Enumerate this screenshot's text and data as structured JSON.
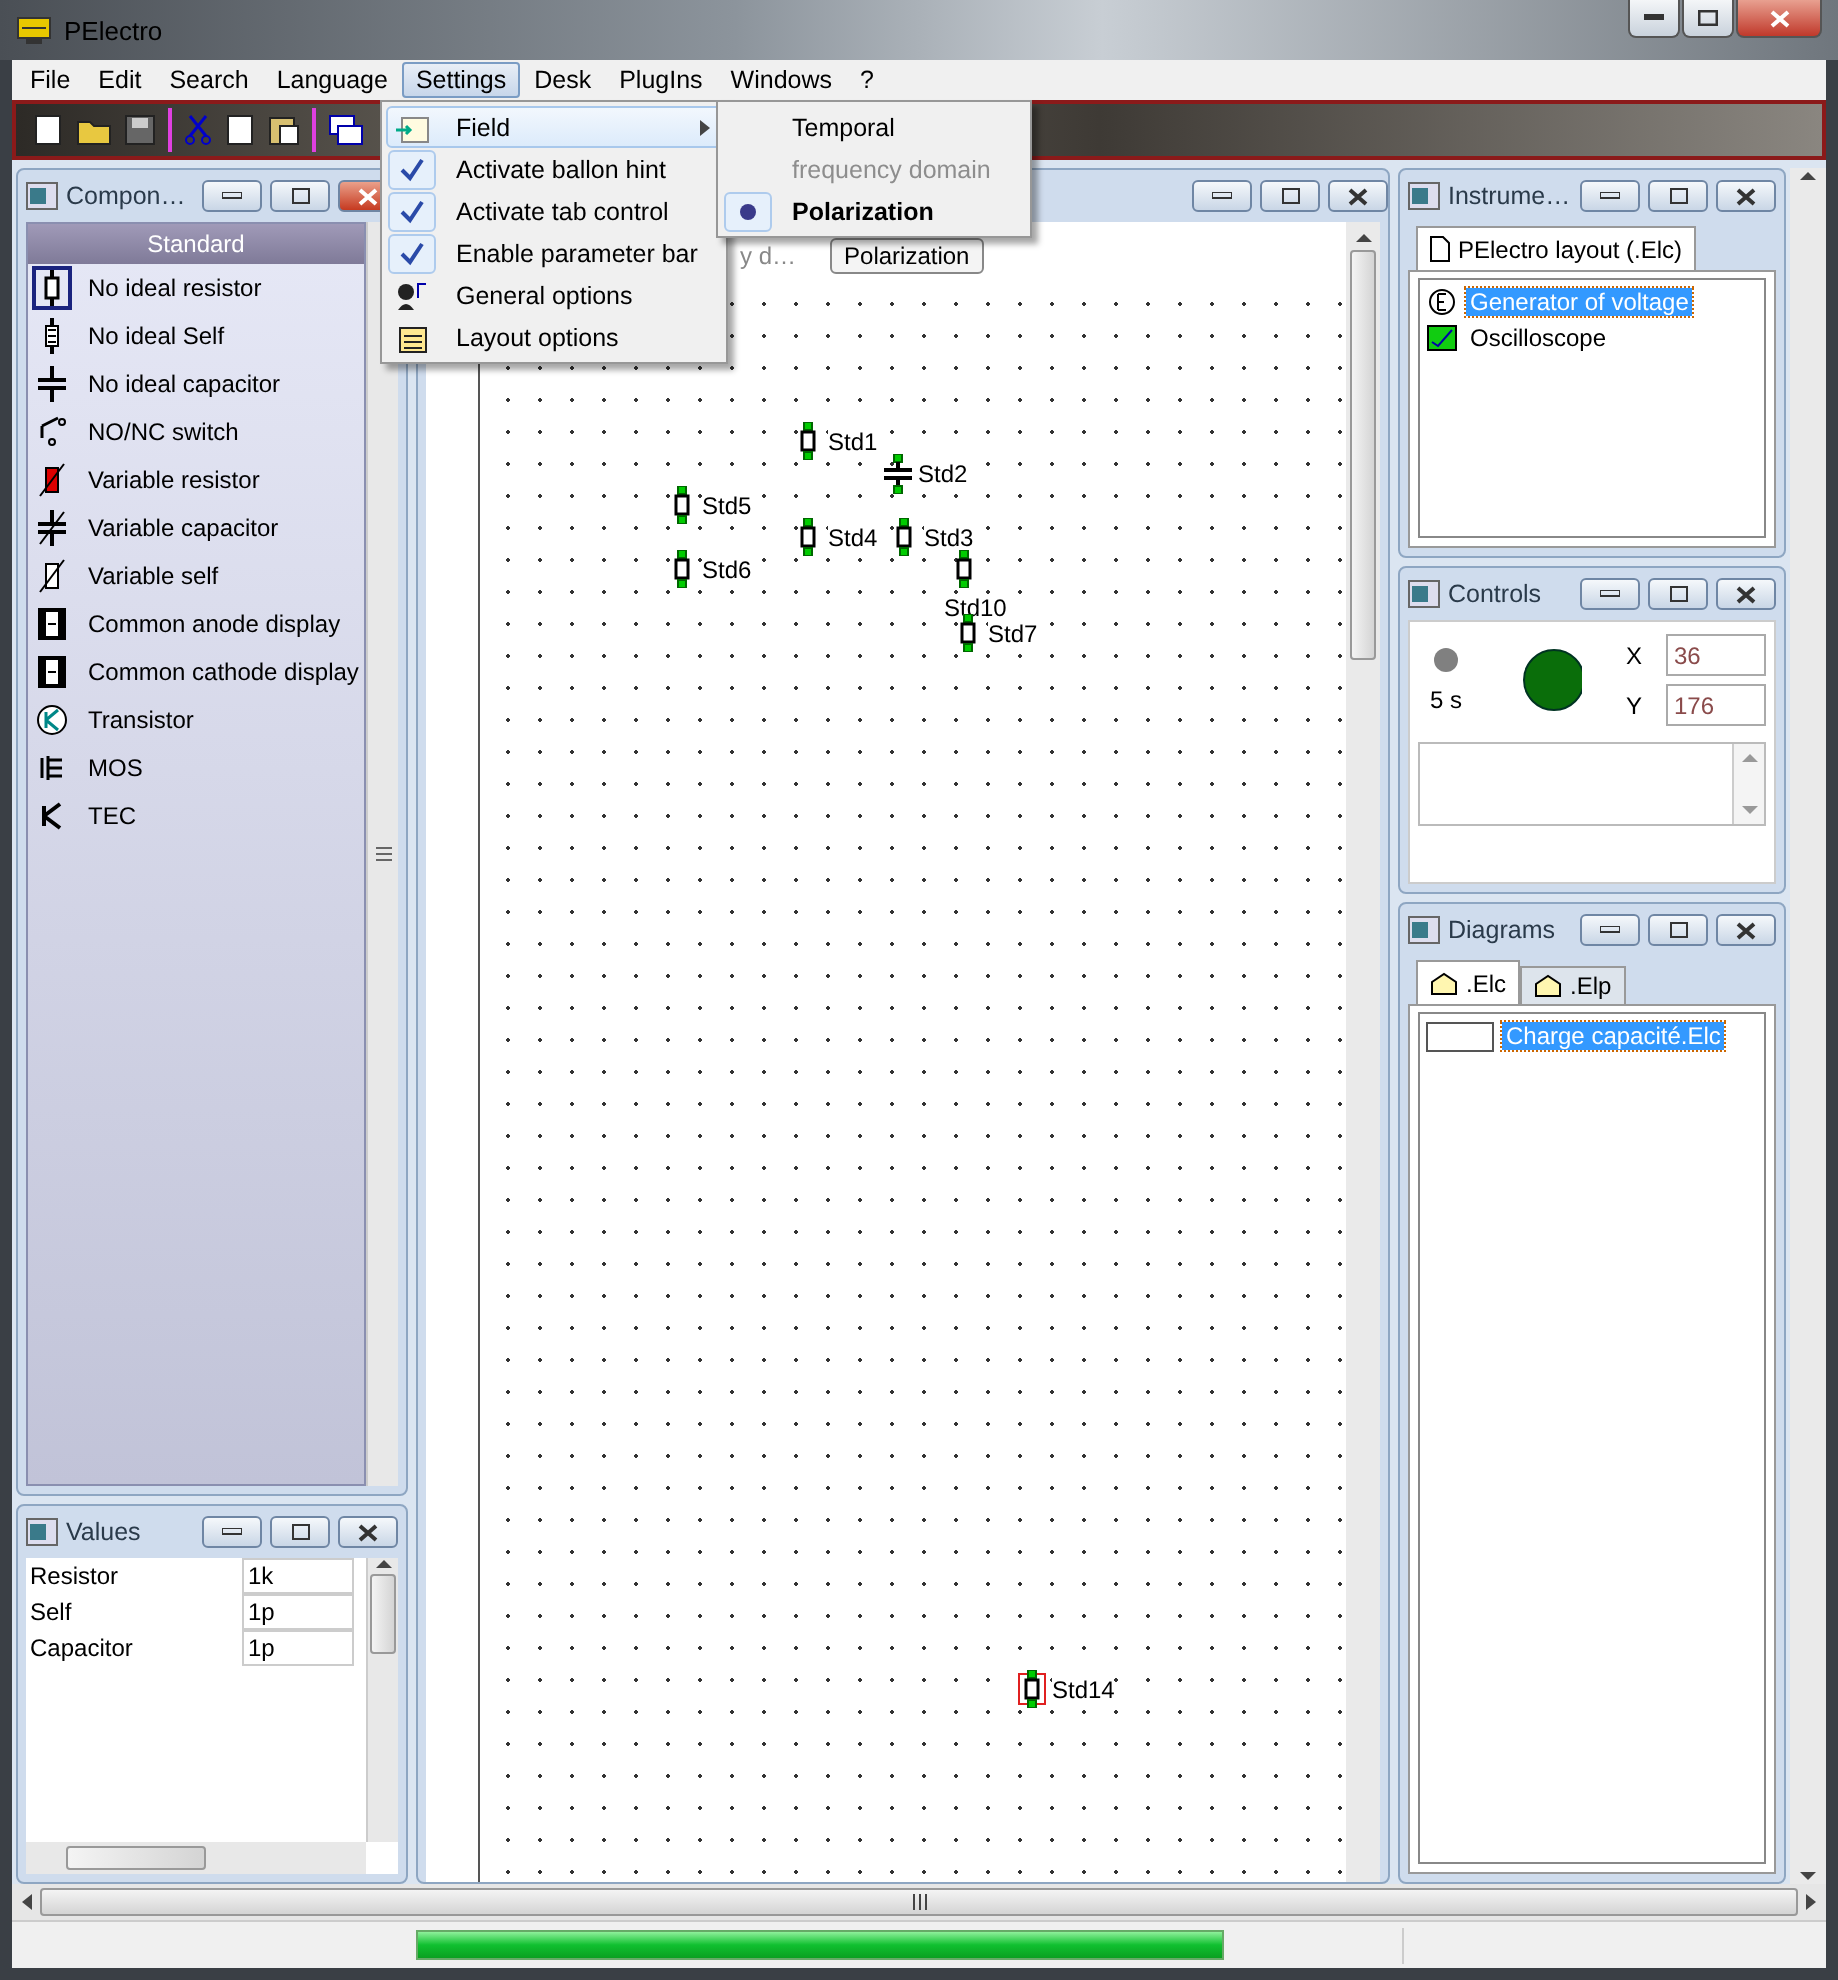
{
  "window": {
    "title": "PElectro"
  },
  "menu_bar": [
    {
      "label": "File",
      "selected": false
    },
    {
      "label": "Edit",
      "selected": false
    },
    {
      "label": "Search",
      "selected": false
    },
    {
      "label": "Language",
      "selected": false
    },
    {
      "label": "Settings",
      "selected": true
    },
    {
      "label": "Desk",
      "selected": false
    },
    {
      "label": "PlugIns",
      "selected": false
    },
    {
      "label": "Windows",
      "selected": false
    },
    {
      "label": "?",
      "selected": false
    }
  ],
  "settings_menu": [
    {
      "kind": "submenu",
      "label": "Field",
      "highlighted": true,
      "checked": false
    },
    {
      "kind": "check",
      "label": "Activate ballon hint",
      "highlighted": false,
      "checked": true
    },
    {
      "kind": "check",
      "label": "Activate tab control",
      "highlighted": false,
      "checked": true
    },
    {
      "kind": "check",
      "label": "Enable parameter bar",
      "highlighted": false,
      "checked": true
    },
    {
      "kind": "general",
      "label": "General options",
      "highlighted": false,
      "checked": false
    },
    {
      "kind": "layout",
      "label": "Layout options",
      "highlighted": false,
      "checked": false
    }
  ],
  "field_submenu": [
    {
      "label": "Temporal",
      "selected": false,
      "disabled": false
    },
    {
      "label": "frequency domain",
      "selected": false,
      "disabled": true
    },
    {
      "label": "Polarization",
      "selected": true,
      "disabled": false
    }
  ],
  "components_panel": {
    "title": "Compon…",
    "group": "Standard",
    "items": [
      {
        "kind": "resistor",
        "label": "No ideal resistor",
        "selected": true
      },
      {
        "kind": "self",
        "label": "No ideal Self",
        "selected": false
      },
      {
        "kind": "capacitor",
        "label": "No ideal capacitor",
        "selected": false
      },
      {
        "kind": "switch",
        "label": "NO/NC switch",
        "selected": false
      },
      {
        "kind": "variable_resistor",
        "label": "Variable resistor",
        "selected": false
      },
      {
        "kind": "variable_capacitor",
        "label": "Variable capacitor",
        "selected": false
      },
      {
        "kind": "variable_self",
        "label": "Variable self",
        "selected": false
      },
      {
        "kind": "display",
        "label": "Common anode display",
        "selected": false
      },
      {
        "kind": "display",
        "label": "Common cathode display",
        "selected": false
      },
      {
        "kind": "transistor",
        "label": "Transistor",
        "selected": false
      },
      {
        "kind": "mos",
        "label": "MOS",
        "selected": false
      },
      {
        "kind": "tec",
        "label": "TEC",
        "selected": false
      }
    ]
  },
  "values_panel": {
    "title": "Values",
    "rows": [
      {
        "name": "Resistor",
        "value": "1k"
      },
      {
        "name": "Self",
        "value": "1p"
      },
      {
        "name": "Capacitor",
        "value": "1p"
      }
    ]
  },
  "document": {
    "tabs": [
      {
        "label": "y d…",
        "selected": false
      },
      {
        "label": "Polarization",
        "selected": true
      }
    ],
    "parts": [
      {
        "kind": "resistor",
        "label": "Std1",
        "selected": false
      },
      {
        "kind": "capacitor",
        "label": "Std2",
        "selected": false
      },
      {
        "kind": "resistor",
        "label": "Std5",
        "selected": false
      },
      {
        "kind": "resistor",
        "label": "Std4",
        "selected": false
      },
      {
        "kind": "resistor",
        "label": "Std3",
        "selected": false
      },
      {
        "kind": "resistor",
        "label": "Std6",
        "selected": false
      },
      {
        "kind": "resistor",
        "label": "Std10",
        "selected": false
      },
      {
        "kind": "resistor",
        "label": "Std7",
        "selected": false
      },
      {
        "kind": "resistor",
        "label": "Std14",
        "selected": true
      }
    ]
  },
  "instruments_panel": {
    "title": "Instrume…",
    "tab": "PElectro layout (.Elc)",
    "items": [
      {
        "kind": "generator",
        "label": "Generator of voltage",
        "selected": true
      },
      {
        "kind": "oscilloscope",
        "label": "Oscilloscope",
        "selected": false
      }
    ]
  },
  "controls_panel": {
    "title": "Controls",
    "timer": "5 s",
    "x_label": "X",
    "x_value": "36",
    "y_label": "Y",
    "y_value": "176"
  },
  "diagrams_panel": {
    "title": "Diagrams",
    "tabs": [
      {
        "label": ".Elc",
        "selected": true
      },
      {
        "label": ".Elp",
        "selected": false
      }
    ],
    "items": [
      {
        "label": "Charge capacité.Elc",
        "selected": true
      }
    ]
  },
  "status_bar": {
    "progress": {
      "level": 0.82
    }
  }
}
